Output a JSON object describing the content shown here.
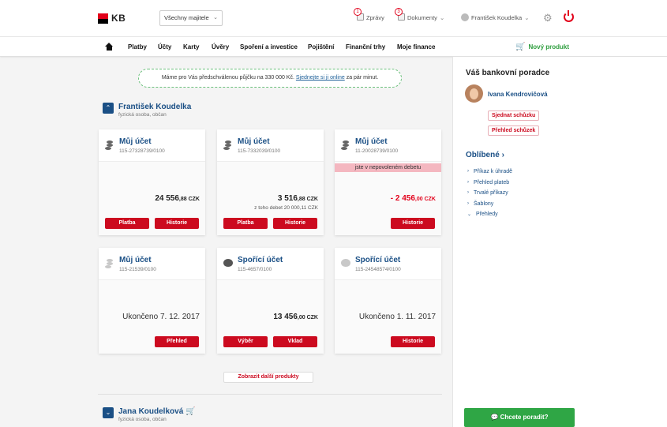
{
  "header": {
    "brand": "KB",
    "owner_select": "Všechny majitele",
    "messages": {
      "label": "Zprávy",
      "count": "1"
    },
    "documents": {
      "label": "Dokumenty",
      "count": "3"
    },
    "user": "František Koudelka"
  },
  "nav": {
    "items": [
      "Platby",
      "Účty",
      "Karty",
      "Úvěry",
      "Spoření a investice",
      "Pojištění",
      "Finanční trhy",
      "Moje finance"
    ],
    "new_product": "Nový produkt"
  },
  "promo": {
    "text1": "Máme pro Vás předschválenou půjčku na 330 000 Kč. ",
    "link": "Sjednejte si ji online",
    "text2": " za pár minut."
  },
  "persons": [
    {
      "name": "František Koudelka",
      "sub": "fyzická osoba, občan"
    },
    {
      "name": "Jana Koudelková",
      "sub": "fyzická osoba, občan"
    }
  ],
  "cards": [
    {
      "title": "Můj účet",
      "number": "115-27328739/0100",
      "amount_main": "24 556",
      "amount_dec": ",88",
      "currency": " CZK",
      "buttons": [
        "Platba",
        "Historie"
      ]
    },
    {
      "title": "Můj účet",
      "number": "115-7332039/0100",
      "amount_main": "3 516",
      "amount_dec": ",88",
      "currency": " CZK",
      "sub": "z toho debet 20 000,11 CZK",
      "buttons": [
        "Platba",
        "Historie"
      ]
    },
    {
      "title": "Můj účet",
      "number": "11-20028739/0100",
      "overdraft": "jste v nepovoleném debetu",
      "amount_main": "- 2 456",
      "amount_dec": ",00",
      "currency": " CZK",
      "buttons": [
        "Historie"
      ]
    },
    {
      "title": "Můj účet",
      "number": "115-21539/0100",
      "ended": "Ukončeno 7. 12. 2017",
      "buttons": [
        "Přehled"
      ]
    },
    {
      "title": "Spořící účet",
      "number": "115-4657/0100",
      "amount_main": "13 456",
      "amount_dec": ",00",
      "currency": " CZK",
      "buttons": [
        "Výběr",
        "Vklad"
      ]
    },
    {
      "title": "Spořící účet",
      "number": "115-24548574/0100",
      "ended": "Ukončeno 1. 11. 2017",
      "buttons": [
        "Historie"
      ]
    }
  ],
  "more_button": "Zobrazit další produkty",
  "sidebar": {
    "heading": "Váš bankovní poradce",
    "advisor": "Ivana Kendrovičová",
    "btn_meeting": "Sjednat schůzku",
    "btn_overview": "Přehled schůzek",
    "fav_heading": "Oblíbené",
    "fav_items": [
      "Příkaz k úhradě",
      "Přehled plateb",
      "Trvalé příkazy",
      "Šablony",
      "Přehledy"
    ],
    "advise_button": "Chcete poradit?"
  },
  "colors": {
    "accent": "#cc0a1f",
    "brand_blue": "#1a4f85",
    "green": "#2fa645"
  }
}
